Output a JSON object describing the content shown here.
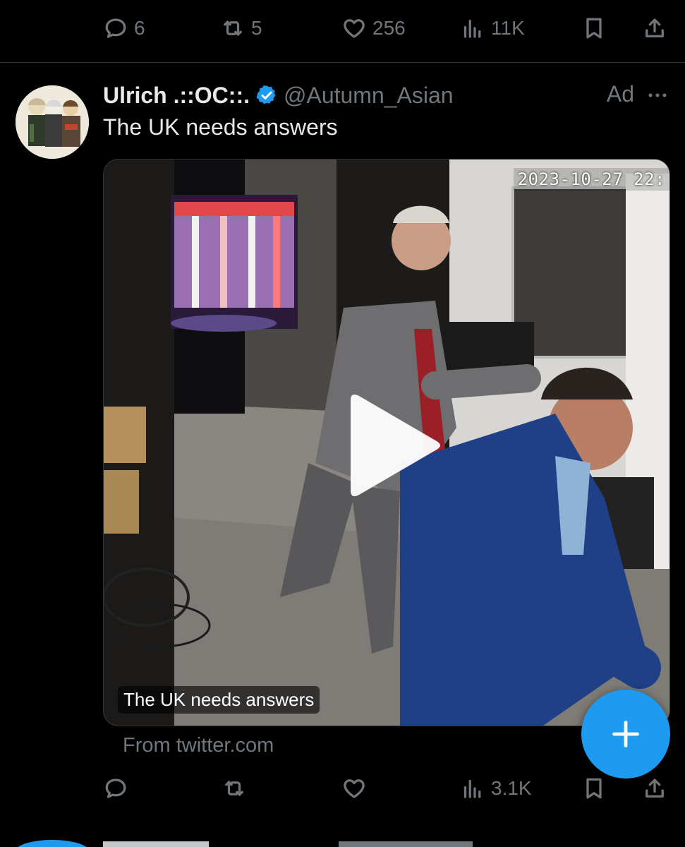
{
  "prev_tweet": {
    "actions": {
      "reply_count": "6",
      "retweet_count": "5",
      "like_count": "256",
      "views_count": "11K"
    }
  },
  "tweet": {
    "author": {
      "display_name": "Ulrich .::OC::.",
      "handle": "@Autumn_Asian",
      "verified": true
    },
    "ad_label": "Ad",
    "text": "The UK needs answers",
    "media": {
      "type": "video",
      "timestamp": "2023-10-27  22:",
      "caption": "The UK needs answers"
    },
    "source": "From twitter.com",
    "actions": {
      "reply_count": "",
      "retweet_count": "",
      "like_count": "",
      "views_count": "3.1K"
    }
  },
  "colors": {
    "background": "#000000",
    "text_primary": "#e7e9ea",
    "text_secondary": "#71767b",
    "accent": "#1d9bf0",
    "divider": "#2f3336"
  },
  "icons": [
    "reply-icon",
    "retweet-icon",
    "like-icon",
    "views-icon",
    "bookmark-icon",
    "share-icon",
    "verified-icon",
    "more-icon",
    "play-icon",
    "plus-icon"
  ]
}
